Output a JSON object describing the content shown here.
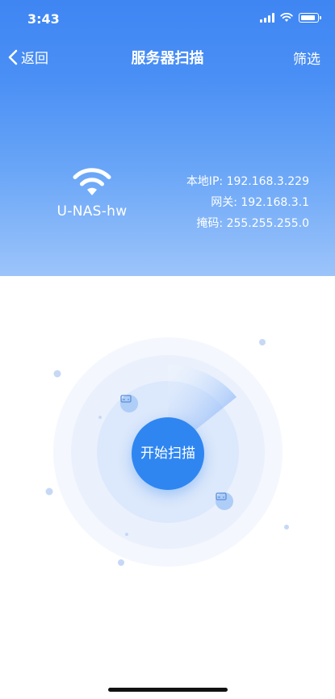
{
  "status_bar": {
    "time": "3:43"
  },
  "nav": {
    "back_label": "返回",
    "title": "服务器扫描",
    "filter_label": "筛选"
  },
  "device": {
    "name": "U-NAS-hw",
    "info": [
      {
        "label": "本地IP:",
        "value": "192.168.3.229"
      },
      {
        "label": "网关:",
        "value": "192.168.3.1"
      },
      {
        "label": "掩码:",
        "value": "255.255.255.0"
      }
    ]
  },
  "scan": {
    "button_label": "开始扫描"
  },
  "icons": [
    "chevron-left-icon",
    "signal-icon",
    "wifi-status-icon",
    "battery-icon",
    "wifi-icon",
    "server-icon"
  ],
  "colors": {
    "primary": "#2f86f1",
    "header_top": "#3f86f3",
    "header_bottom": "#9cc4fa"
  }
}
